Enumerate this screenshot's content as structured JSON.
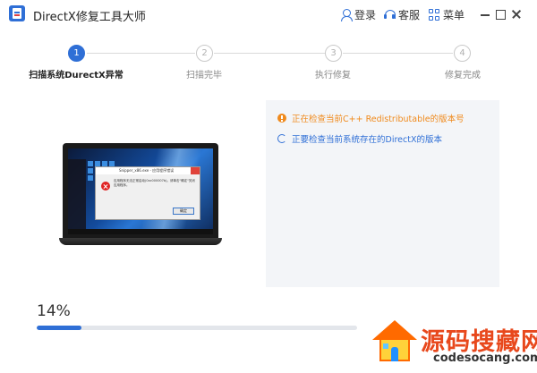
{
  "window": {
    "title": "DirectX修复工具大师"
  },
  "header": {
    "login_label": "登录",
    "service_label": "客服",
    "menu_label": "菜单",
    "icons": [
      "user-icon",
      "headset-icon",
      "grid-icon",
      "minimize-icon",
      "maximize-icon",
      "close-icon"
    ]
  },
  "steps": [
    {
      "number": "1",
      "label": "扫描系统DurectX异常",
      "state": "active"
    },
    {
      "number": "2",
      "label": "扫描完毕",
      "state": "pending"
    },
    {
      "number": "3",
      "label": "执行修复",
      "state": "pending"
    },
    {
      "number": "4",
      "label": "修复完成",
      "state": "pending"
    }
  ],
  "illustration": {
    "dialog_title": "Snipper_x86.exe - 应用程序错误",
    "dialog_message": "应用程序无法正常启动(0xc000007b)。请单击\"确定\"关闭应用程序。",
    "dialog_button": "确定"
  },
  "status": {
    "items": [
      {
        "icon": "warning-icon",
        "text": "正在检查当前C++ Redistributable的版本号",
        "color": "#f08a1c"
      },
      {
        "icon": "loading-icon",
        "text": "正要检查当前系统存在的DirectX的版本",
        "color": "#2f6fd6"
      }
    ]
  },
  "progress": {
    "percent_label": "14%",
    "fraction": 0.14
  },
  "watermark": {
    "text": "源码搜藏网",
    "url": "codesocang.com"
  },
  "colors": {
    "accent": "#2f6fd6",
    "warning": "#f08a1c",
    "panel_bg": "#f3f5f8"
  }
}
